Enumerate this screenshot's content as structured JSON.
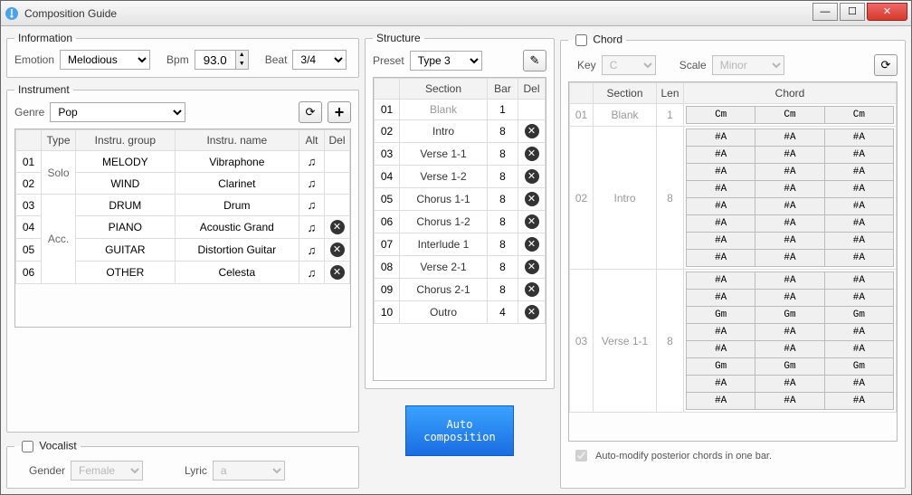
{
  "window": {
    "title": "Composition Guide"
  },
  "info": {
    "legend": "Information",
    "emotion_label": "Emotion",
    "emotion": "Melodious",
    "bpm_label": "Bpm",
    "bpm": "93.0",
    "beat_label": "Beat",
    "beat": "3/4"
  },
  "instr": {
    "legend": "Instrument",
    "genre_label": "Genre",
    "genre": "Pop",
    "headers": {
      "idx": "",
      "type": "Type",
      "group": "Instru. group",
      "name": "Instru. name",
      "alt": "Alt",
      "del": "Del"
    },
    "rows": [
      {
        "idx": "01",
        "type": "Solo",
        "group": "MELODY",
        "name": "Vibraphone",
        "alt": true,
        "del": false,
        "type_rowspan": 2
      },
      {
        "idx": "02",
        "type": "",
        "group": "WIND",
        "name": "Clarinet",
        "alt": true,
        "del": false,
        "type_skip": true
      },
      {
        "idx": "03",
        "type": "Acc.",
        "group": "DRUM",
        "name": "Drum",
        "alt": true,
        "del": false,
        "type_rowspan": 4
      },
      {
        "idx": "04",
        "type": "",
        "group": "PIANO",
        "name": "Acoustic Grand",
        "alt": true,
        "del": true,
        "type_skip": true
      },
      {
        "idx": "05",
        "type": "",
        "group": "GUITAR",
        "name": "Distortion Guitar",
        "alt": true,
        "del": true,
        "type_skip": true
      },
      {
        "idx": "06",
        "type": "",
        "group": "OTHER",
        "name": "Celesta",
        "alt": true,
        "del": true,
        "type_skip": true
      }
    ]
  },
  "vocalist": {
    "legend": "Vocalist",
    "enabled": false,
    "gender_label": "Gender",
    "gender": "Female",
    "lyric_label": "Lyric",
    "lyric": "a"
  },
  "struct": {
    "legend": "Structure",
    "preset_label": "Preset",
    "preset": "Type 3",
    "headers": {
      "idx": "",
      "section": "Section",
      "bar": "Bar",
      "del": "Del"
    },
    "rows": [
      {
        "idx": "01",
        "section": "Blank",
        "bar": "1",
        "del": false
      },
      {
        "idx": "02",
        "section": "Intro",
        "bar": "8",
        "del": true
      },
      {
        "idx": "03",
        "section": "Verse 1-1",
        "bar": "8",
        "del": true
      },
      {
        "idx": "04",
        "section": "Verse 1-2",
        "bar": "8",
        "del": true
      },
      {
        "idx": "05",
        "section": "Chorus 1-1",
        "bar": "8",
        "del": true
      },
      {
        "idx": "06",
        "section": "Chorus 1-2",
        "bar": "8",
        "del": true
      },
      {
        "idx": "07",
        "section": "Interlude 1",
        "bar": "8",
        "del": true
      },
      {
        "idx": "08",
        "section": "Verse 2-1",
        "bar": "8",
        "del": true
      },
      {
        "idx": "09",
        "section": "Chorus 2-1",
        "bar": "8",
        "del": true
      },
      {
        "idx": "10",
        "section": "Outro",
        "bar": "4",
        "del": true
      }
    ]
  },
  "autobtn": "Auto composition",
  "chord": {
    "legend": "Chord",
    "enabled": false,
    "key_label": "Key",
    "key": "C",
    "scale_label": "Scale",
    "scale": "Minor",
    "headers": {
      "idx": "",
      "section": "Section",
      "len": "Len",
      "chord": "Chord"
    },
    "automod": "Auto-modify posterior chords in one bar.",
    "rows": [
      {
        "idx": "01",
        "section": "Blank",
        "len": "1",
        "chords": [
          [
            "Cm",
            "Cm",
            "Cm"
          ]
        ]
      },
      {
        "idx": "02",
        "section": "Intro",
        "len": "8",
        "chords": [
          [
            "#A",
            "#A",
            "#A"
          ],
          [
            "#A",
            "#A",
            "#A"
          ],
          [
            "#A",
            "#A",
            "#A"
          ],
          [
            "#A",
            "#A",
            "#A"
          ],
          [
            "#A",
            "#A",
            "#A"
          ],
          [
            "#A",
            "#A",
            "#A"
          ],
          [
            "#A",
            "#A",
            "#A"
          ],
          [
            "#A",
            "#A",
            "#A"
          ]
        ]
      },
      {
        "idx": "03",
        "section": "Verse 1-1",
        "len": "8",
        "chords": [
          [
            "#A",
            "#A",
            "#A"
          ],
          [
            "#A",
            "#A",
            "#A"
          ],
          [
            "Gm",
            "Gm",
            "Gm"
          ],
          [
            "#A",
            "#A",
            "#A"
          ],
          [
            "#A",
            "#A",
            "#A"
          ],
          [
            "Gm",
            "Gm",
            "Gm"
          ],
          [
            "#A",
            "#A",
            "#A"
          ],
          [
            "#A",
            "#A",
            "#A"
          ]
        ]
      }
    ]
  }
}
